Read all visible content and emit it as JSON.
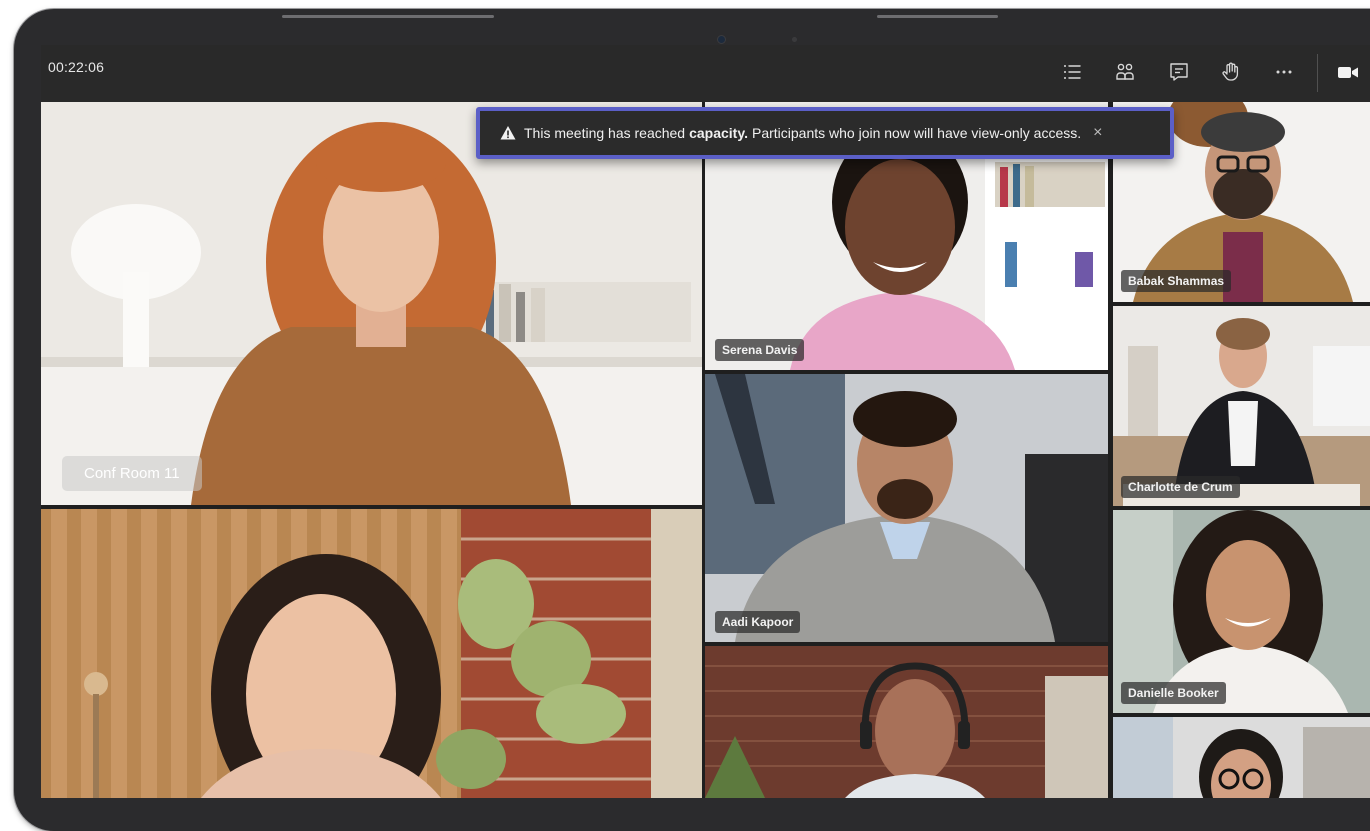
{
  "meeting": {
    "timer": "00:22:06"
  },
  "toolbar": {
    "buttons": [
      {
        "icon": "participants-list-icon"
      },
      {
        "icon": "people-icon"
      },
      {
        "icon": "chat-icon"
      },
      {
        "icon": "raise-hand-icon"
      },
      {
        "icon": "more-options-icon"
      },
      {
        "icon": "video-camera-icon"
      }
    ]
  },
  "banner": {
    "lead": "This meeting has reached",
    "emphasis": "capacity.",
    "rest": "Participants who join now will have view-only access.",
    "close": "×",
    "accent": "#5b5fc7"
  },
  "participants": {
    "conf_room": "Conf Room 11",
    "serena": "Serena Davis",
    "babak": "Babak Shammas",
    "charlotte": "Charlotte de Crum",
    "aadi": "Aadi Kapoor",
    "danielle": "Danielle Booker"
  }
}
